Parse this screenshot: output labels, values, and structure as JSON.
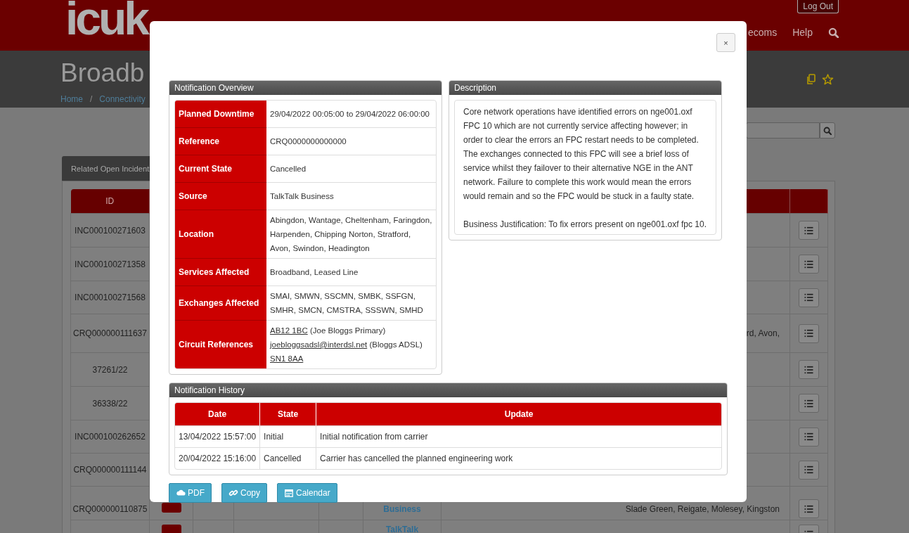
{
  "header": {
    "logo": "icuk",
    "logout": "Log Out",
    "nav": [
      "ecoms",
      "Help"
    ]
  },
  "page": {
    "title": "Broadb",
    "breadcrumb": [
      "Home",
      "/",
      "Connectivity"
    ]
  },
  "tab": "Related Open Incident",
  "table": {
    "columns": [
      "ID"
    ],
    "rows": [
      {
        "id": "INC000100271603"
      },
      {
        "id": "INC000100271358"
      },
      {
        "id": "INC000100271568"
      },
      {
        "id": "CRQ000000111637",
        "location": "rd, Avon,"
      },
      {
        "id": "37261/22"
      },
      {
        "id": "36338/22"
      },
      {
        "id": "INC000100262652"
      },
      {
        "id": "CRQ000000111144"
      },
      {
        "id": "CRQ000000110875",
        "badge": true,
        "source": "Business",
        "location": "Slade Green, Reigate, Molesey, Kingston"
      },
      {
        "badge": true,
        "source": "TalkTalk"
      }
    ]
  },
  "modal": {
    "close": "×",
    "overview": {
      "title": "Notification Overview",
      "rows": [
        {
          "label": "Planned Downtime",
          "value": "29/04/2022 00:05:00 to 29/04/2022 06:00:00"
        },
        {
          "label": "Reference",
          "value": "CRQ0000000000000"
        },
        {
          "label": "Current State",
          "value": "Cancelled"
        },
        {
          "label": "Source",
          "value": "TalkTalk Business"
        },
        {
          "label": "Location",
          "value": "Abingdon, Wantage, Cheltenham, Faringdon, Harpenden, Chipping Norton, Stratford, Avon, Swindon, Headington"
        },
        {
          "label": "Services Affected",
          "value": "Broadband, Leased Line"
        },
        {
          "label": "Exchanges Affected",
          "value": "SMAI, SMWN, SSCMN, SMBK, SSFGN, SMHR, SMCN, CMSTRA, SSSWN, SMHD"
        },
        {
          "label": "Circuit References",
          "references": [
            {
              "link": "AB12 1BC",
              "note": "(Joe Bloggs Primary)"
            },
            {
              "link": "joebloggsadsl@interdsl.net",
              "note": "(Bloggs ADSL)"
            },
            {
              "link": "SN1 8AA"
            }
          ]
        }
      ]
    },
    "description": {
      "title": "Description",
      "paragraphs": [
        "Core network operations have identified errors on nge001.oxf FPC 10 which are not currently service affecting however; in order to clear the errors an FPC restart needs to be completed. The exchanges connected to this FPC will see a brief loss of service whilst they failover to their alternative NGE in the ANT network. Failure to complete this work would mean the errors would remain and so the FPC would be stuck in a faulty state.",
        "Business Justification: To fix errors present on nge001.oxf fpc 10."
      ]
    },
    "history": {
      "title": "Notification History",
      "columns": [
        "Date",
        "State",
        "Update"
      ],
      "rows": [
        [
          "13/04/2022 15:57:00",
          "Initial",
          "Initial notification from carrier"
        ],
        [
          "20/04/2022 15:16:00",
          "Cancelled",
          "Carrier has cancelled the planned engineering work"
        ]
      ]
    },
    "buttons": [
      {
        "label": "PDF"
      },
      {
        "label": "Copy"
      },
      {
        "label": "Calendar"
      }
    ]
  }
}
